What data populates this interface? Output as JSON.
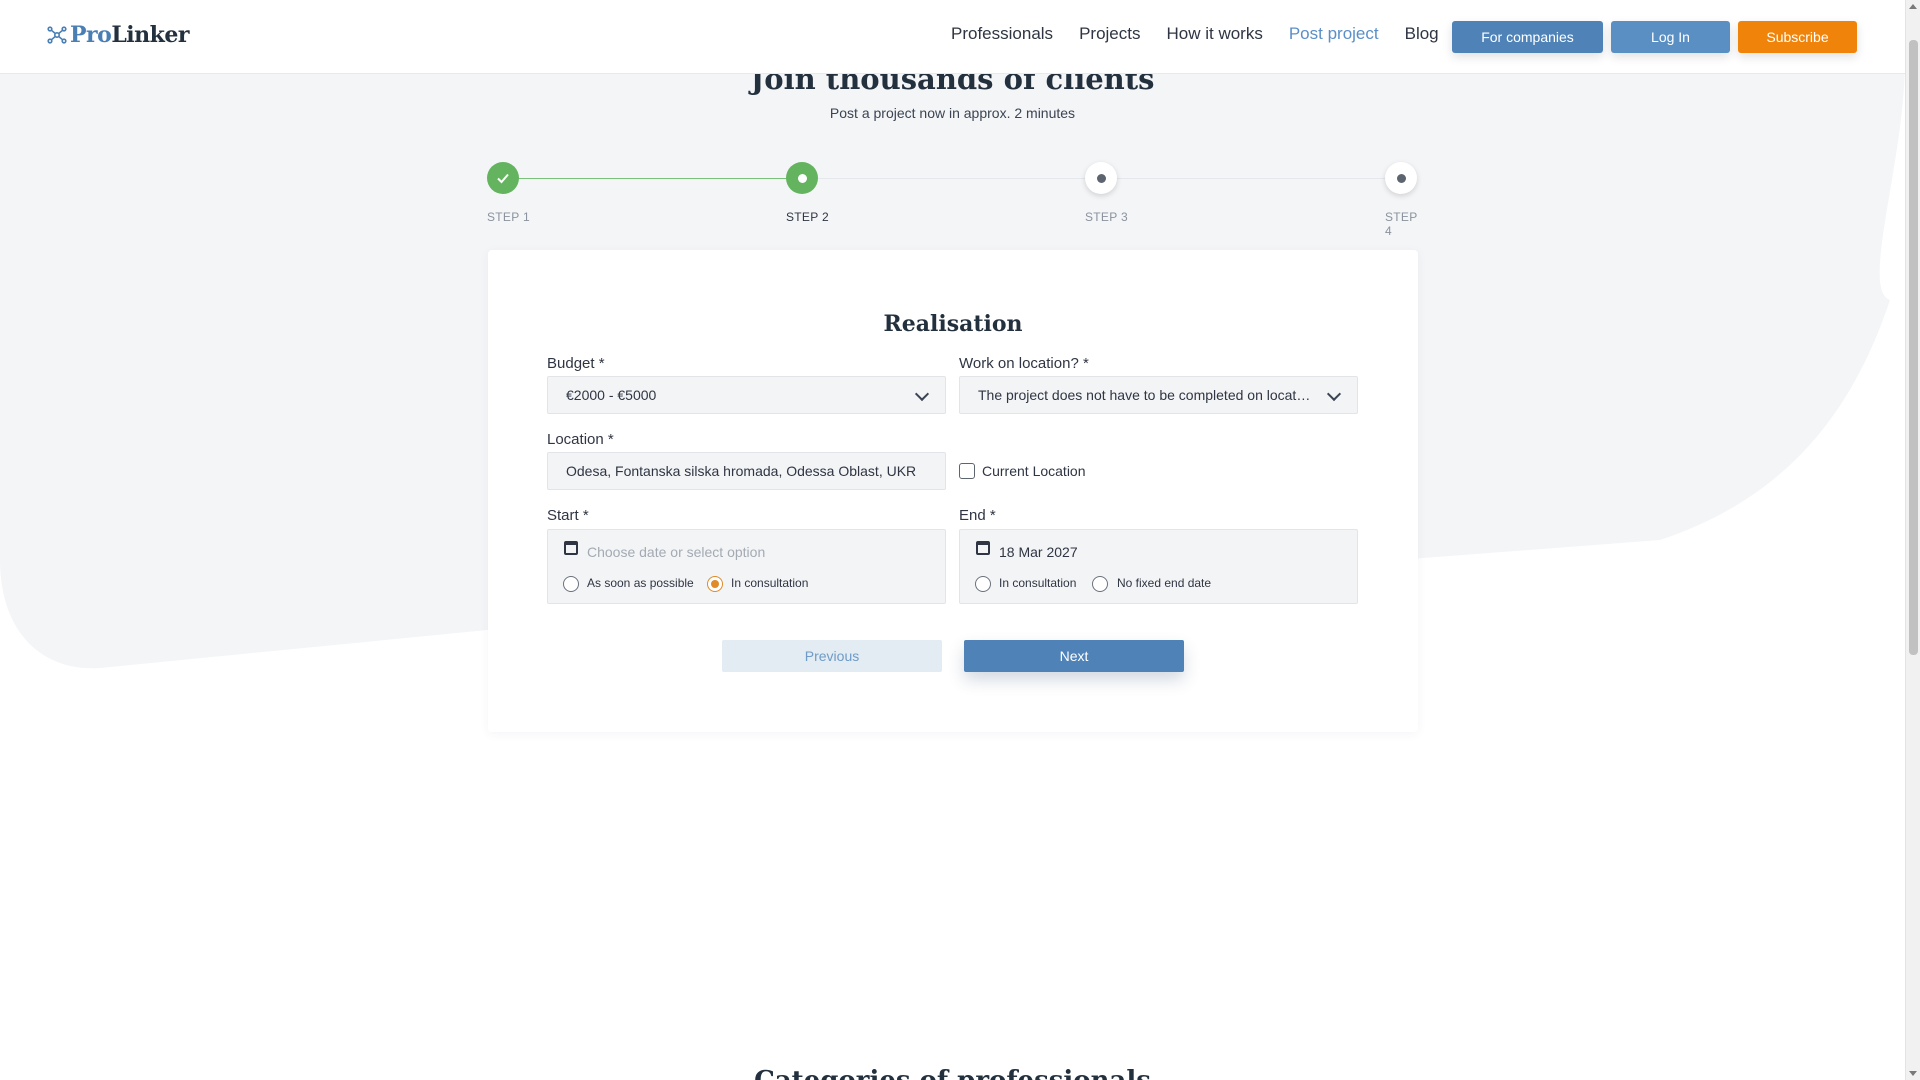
{
  "header": {
    "brand_pro": "Pro",
    "brand_linker": "Linker",
    "nav": [
      "Professionals",
      "Projects",
      "How it works",
      "Post project",
      "Blog"
    ],
    "active_nav": "Post project",
    "for_companies": "For companies",
    "login": "Log In",
    "subscribe": "Subscribe"
  },
  "hero": {
    "title": "Join thousands of clients",
    "subtitle": "Post a project now in approx. 2 minutes"
  },
  "stepper": {
    "steps": [
      "STEP 1",
      "STEP 2",
      "STEP 3",
      "STEP 4"
    ],
    "current_step": 2,
    "completed_steps": 1
  },
  "form": {
    "title": "Realisation",
    "budget": {
      "label": "Budget *",
      "value": "€2000 - €5000"
    },
    "work_on_location": {
      "label": "Work on location? *",
      "value": "The project does not have to be completed on location (remote)"
    },
    "location": {
      "label": "Location *",
      "value": "Odesa, Fontanska silska hromada, Odessa Oblast, UKR"
    },
    "current_location": {
      "label": "Current Location",
      "checked": false
    },
    "start": {
      "label": "Start *",
      "placeholder": "Choose date or select option",
      "option_asap": "As soon as possible",
      "option_consultation": "In consultation",
      "selected": "In consultation"
    },
    "end": {
      "label": "End *",
      "value": "18 Mar 2027",
      "option_consultation": "In consultation",
      "option_no_end": "No fixed end date",
      "selected": null
    },
    "previous": "Previous",
    "next": "Next"
  },
  "bottom": {
    "heading": "Categories of professionals"
  },
  "colors": {
    "primary": "#4f83b8",
    "accent": "#f0840a",
    "success": "#64b45f",
    "radio_checked": "#e08a2a"
  }
}
